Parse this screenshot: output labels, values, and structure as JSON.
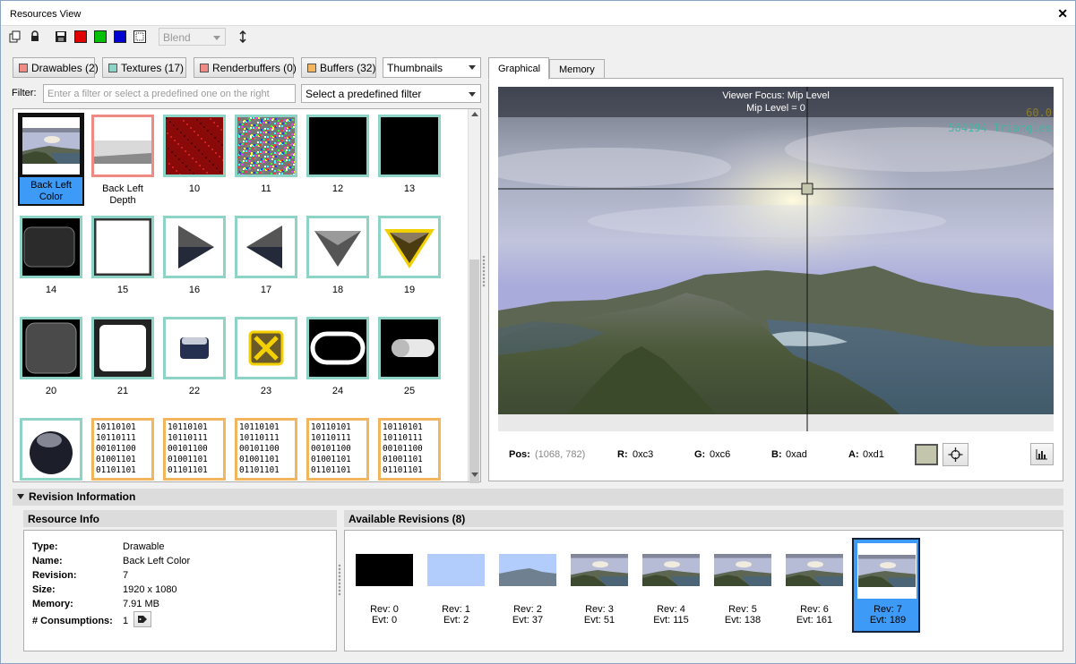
{
  "window": {
    "title": "Resources View"
  },
  "toolbar": {
    "blend": "Blend",
    "swatches": [
      "#e00000",
      "#00c000",
      "#0000d0"
    ]
  },
  "categories": [
    {
      "label": "Drawables (2)",
      "color": "#ef8a84"
    },
    {
      "label": "Textures (17)",
      "color": "#8dd4c6"
    },
    {
      "label": "Renderbuffers (0)",
      "color": "#ef8a84"
    },
    {
      "label": "Buffers (32)",
      "color": "#f3b55e"
    }
  ],
  "view_mode": "Thumbnails",
  "filter": {
    "label": "Filter:",
    "placeholder": "Enter a filter or select a predefined one on the right",
    "predefined": "Select a predefined filter"
  },
  "thumbnails": [
    {
      "label": "Back Left Color",
      "kind": "scene"
    },
    {
      "label": "Back Left Depth",
      "kind": "depth"
    },
    {
      "label": "10",
      "kind": "red-noise"
    },
    {
      "label": "11",
      "kind": "color-noise"
    },
    {
      "label": "12",
      "kind": "black"
    },
    {
      "label": "13",
      "kind": "black"
    },
    {
      "label": "14",
      "kind": "dark-rounded"
    },
    {
      "label": "15",
      "kind": "white-square"
    },
    {
      "label": "16",
      "kind": "arrow-right"
    },
    {
      "label": "17",
      "kind": "arrow-left"
    },
    {
      "label": "18",
      "kind": "arrow-down"
    },
    {
      "label": "19",
      "kind": "arrow-down-gold"
    },
    {
      "label": "20",
      "kind": "gray-rounded"
    },
    {
      "label": "21",
      "kind": "white-glow"
    },
    {
      "label": "22",
      "kind": "small-button"
    },
    {
      "label": "23",
      "kind": "gold-x"
    },
    {
      "label": "24",
      "kind": "pill-outline"
    },
    {
      "label": "25",
      "kind": "pill-white"
    },
    {
      "label": "",
      "kind": "sphere"
    },
    {
      "label": "",
      "kind": "binary"
    },
    {
      "label": "",
      "kind": "binary"
    },
    {
      "label": "",
      "kind": "binary"
    },
    {
      "label": "",
      "kind": "binary"
    },
    {
      "label": "",
      "kind": "binary"
    }
  ],
  "binary_text": "10110101\n10110111\n00101100\n01001101\n01101101",
  "tabs": [
    "Graphical",
    "Memory"
  ],
  "viewer": {
    "focus": "Viewer Focus: Mip Level",
    "mip": "Mip Level = 0",
    "fps": "60.0",
    "triangles": "584194 Triangles"
  },
  "readout": {
    "pos_label": "Pos:",
    "pos_value": "(1068, 782)",
    "r_label": "R:",
    "r_value": "0xc3",
    "g_label": "G:",
    "g_value": "0xc6",
    "b_label": "B:",
    "b_value": "0xad",
    "a_label": "A:",
    "a_value": "0xd1",
    "pixel_color": "#c3c6ad"
  },
  "revision_section": "Revision Information",
  "resource_info": {
    "title": "Resource Info",
    "rows": [
      {
        "label": "Type:",
        "value": "Drawable"
      },
      {
        "label": "Name:",
        "value": "Back Left Color"
      },
      {
        "label": "Revision:",
        "value": "7"
      },
      {
        "label": "Size:",
        "value": "1920 x 1080"
      },
      {
        "label": "Memory:",
        "value": "7.91 MB"
      },
      {
        "label": "# Consumptions:",
        "value": "1"
      }
    ]
  },
  "revisions": {
    "title": "Available Revisions (8)",
    "items": [
      {
        "rev": "Rev: 0",
        "evt": "Evt: 0",
        "kind": "black"
      },
      {
        "rev": "Rev: 1",
        "evt": "Evt: 2",
        "kind": "blue"
      },
      {
        "rev": "Rev: 2",
        "evt": "Evt: 37",
        "kind": "sky"
      },
      {
        "rev": "Rev: 3",
        "evt": "Evt: 51",
        "kind": "scene"
      },
      {
        "rev": "Rev: 4",
        "evt": "Evt: 115",
        "kind": "scene"
      },
      {
        "rev": "Rev: 5",
        "evt": "Evt: 138",
        "kind": "scene"
      },
      {
        "rev": "Rev: 6",
        "evt": "Evt: 161",
        "kind": "scene"
      },
      {
        "rev": "Rev: 7",
        "evt": "Evt: 189",
        "kind": "scene"
      }
    ]
  }
}
